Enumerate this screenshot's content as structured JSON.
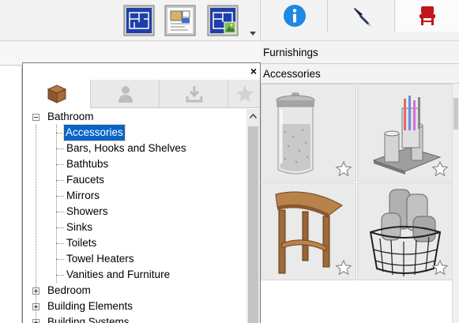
{
  "toolbar": {
    "buttons": [
      {
        "name": "plan-view-icon"
      },
      {
        "name": "plan-document-icon"
      },
      {
        "name": "plan-3d-icon"
      }
    ],
    "dropdown_icon": "chevron-down-icon"
  },
  "panel_tabs": [
    {
      "name": "info-icon"
    },
    {
      "name": "pen-icon"
    },
    {
      "name": "chair-icon"
    }
  ],
  "catalog": {
    "header": "Furnishings",
    "subheader": "Accessories",
    "items": [
      {
        "name": "glass-canister"
      },
      {
        "name": "toothbrush-holder-set"
      },
      {
        "name": "wooden-corner-stool"
      },
      {
        "name": "wire-basket-towels"
      }
    ]
  },
  "floating_window": {
    "close_label": "×",
    "tabs": [
      {
        "name": "library-box-icon"
      },
      {
        "name": "user-icon"
      },
      {
        "name": "download-icon"
      },
      {
        "name": "star-icon"
      }
    ],
    "tree": [
      {
        "label": "Bathroom",
        "expanded": true
      },
      {
        "label": "Accessories",
        "selected": true
      },
      {
        "label": "Bars, Hooks and Shelves"
      },
      {
        "label": "Bathtubs"
      },
      {
        "label": "Faucets"
      },
      {
        "label": "Mirrors"
      },
      {
        "label": "Showers"
      },
      {
        "label": "Sinks"
      },
      {
        "label": "Toilets"
      },
      {
        "label": "Towel Heaters"
      },
      {
        "label": "Vanities and Furniture"
      },
      {
        "label": "Bedroom",
        "expanded": false
      },
      {
        "label": "Building Elements",
        "expanded": false
      },
      {
        "label": "Building Systems",
        "expanded": false
      }
    ]
  },
  "colors": {
    "selection": "#0a64c8",
    "info_blue": "#1e88e5",
    "chair_red": "#c0161e"
  }
}
